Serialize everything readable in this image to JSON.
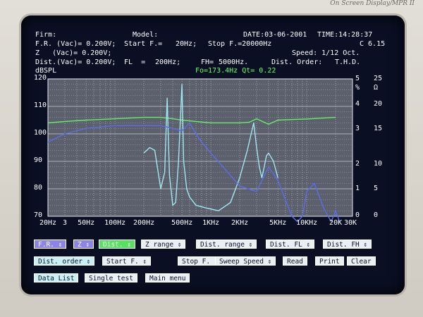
{
  "brand": "On Screen Display/MPR II",
  "header": {
    "firm": "Firm:",
    "model": "Model:",
    "date": "DATE:03-06-2001",
    "time": "TIME:14:28:37",
    "fr_vac": "F.R. (Vac)= 0.200V;",
    "start_f": "Start F.=",
    "start_val": "20Hz;",
    "stop_f": "Stop F.=20000Hz",
    "channel": "C 6.15",
    "z_vac": "Z   (Vac)= 0.200V;",
    "speed": "Speed: 1/12 Oct.",
    "dist_vac": "Dist.(Vac)= 0.200V;",
    "fl": "FL  =",
    "fl_val": "200Hz;",
    "fh": "FH=",
    "fh_val": "5000Hz.",
    "dist_order": "Dist. Order:",
    "thd": "T.H.D.",
    "fo_qt": "Fo=173.4Hz Qt= 0.22",
    "ylabel": "dBSPL"
  },
  "axes": {
    "left_ticks": [
      "120",
      "110",
      "100",
      "90",
      "80",
      "70"
    ],
    "right_pct_ticks": [
      "5",
      "%",
      "4",
      "3",
      "2",
      "1",
      "0"
    ],
    "right_ohm_ticks": [
      "25",
      "Ω",
      "20",
      "15",
      "10",
      "5",
      "0"
    ],
    "x_ticks": [
      "20Hz",
      "3",
      "50Hz",
      "100Hz",
      "200Hz",
      "500Hz",
      "1KHz",
      "2KHz",
      "5KHz",
      "10KHz",
      "20K",
      "30K"
    ]
  },
  "buttons_row1": [
    "F.R. ⇕",
    "Z ⇕",
    "Dist. ⇕",
    "Z range ⇕",
    "Dist. range ⇕",
    "Dist. FL ⇕",
    "Dist. FH ⇕"
  ],
  "buttons_row2": [
    "Dist. order ⇕",
    "Start F. ⇕",
    "Stop F. ⇕",
    "Sweep Speed ⇕",
    "Read",
    "Print",
    "Clear"
  ],
  "buttons_row3": [
    "Data List",
    "Single test",
    "Main menu"
  ],
  "colors": {
    "fr_trace": "#66ee66",
    "impedance_trace": "#9fe8f0",
    "distortion_trace": "#5b6cf0",
    "grid": "#c8c8d8"
  },
  "chart_data": {
    "type": "line",
    "x_scale": "log",
    "xlim": [
      20,
      30000
    ],
    "ylim": [
      70,
      120
    ],
    "ylabel": "dBSPL",
    "series": [
      {
        "name": "F.R.",
        "x": [
          20,
          30,
          50,
          100,
          200,
          300,
          400,
          500,
          700,
          1000,
          2000,
          2500,
          3000,
          4000,
          5000,
          7000,
          10000,
          20000
        ],
        "y": [
          104,
          104.5,
          105,
          105.5,
          106,
          106,
          105.5,
          105,
          104.5,
          104,
          104,
          104.2,
          105.5,
          103.5,
          105,
          105.2,
          105.4,
          106
        ]
      },
      {
        "name": "Z",
        "x": [
          200,
          230,
          260,
          300,
          330,
          350,
          370,
          400,
          430,
          460,
          500,
          520,
          560,
          600,
          700,
          900,
          1200,
          1600,
          2000,
          2400,
          2800,
          3000,
          3200,
          3400,
          3600,
          3800,
          4000,
          4500,
          5000
        ],
        "y": [
          93,
          95,
          94,
          80,
          86,
          113,
          85,
          74,
          75,
          90,
          118,
          90,
          80,
          77,
          74,
          73,
          72,
          75,
          84,
          94,
          104,
          95,
          88,
          84,
          88,
          92,
          93,
          90,
          84
        ]
      },
      {
        "name": "Dist.",
        "x": [
          20,
          30,
          50,
          100,
          200,
          300,
          400,
          500,
          600,
          700,
          800,
          1000,
          1500,
          2000,
          3000,
          4000,
          5000,
          7000,
          8000,
          9000,
          10000,
          12000,
          15000,
          18000,
          20000,
          22000
        ],
        "y": [
          97,
          100,
          102,
          103,
          103,
          103,
          102,
          101,
          104,
          100,
          97,
          93,
          86,
          81,
          79,
          88,
          83,
          70,
          68,
          70,
          79,
          82,
          73,
          68,
          72,
          68
        ]
      }
    ]
  }
}
